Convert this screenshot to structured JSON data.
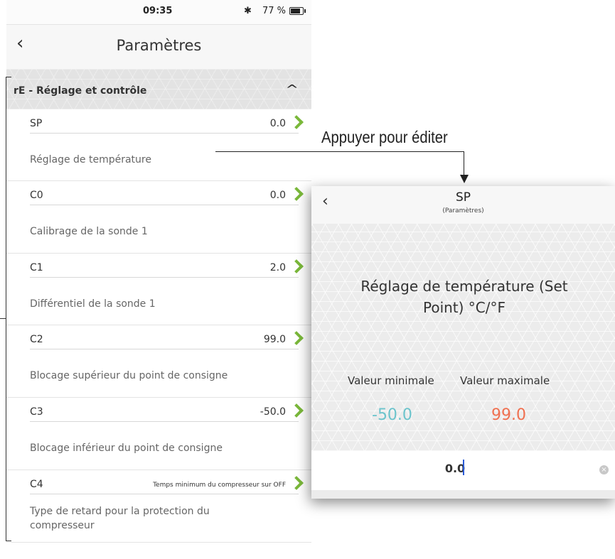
{
  "status_bar": {
    "time": "09:35",
    "bluetooth": "✱",
    "battery": "77 %"
  },
  "nav": {
    "back_icon": "‹",
    "title": "Paramètres"
  },
  "section": {
    "title": "rE - Réglage et contrôle",
    "chevron": "^"
  },
  "params": [
    {
      "code": "SP",
      "value": "0.0",
      "description": "Réglage de température"
    },
    {
      "code": "C0",
      "value": "0.0",
      "description": "Calibrage de la sonde 1"
    },
    {
      "code": "C1",
      "value": "2.0",
      "description": "Différentiel de la sonde 1"
    },
    {
      "code": "C2",
      "value": "99.0",
      "description": "Blocage supérieur du point de consigne"
    },
    {
      "code": "C3",
      "value": "-50.0",
      "description": "Blocage inférieur du point de consigne"
    },
    {
      "code": "C4",
      "value": "Temps minimum du compresseur sur OFF",
      "description": "Type de retard pour la protection du compresseur"
    }
  ],
  "annotation": {
    "text": "Appuyer pour éditer"
  },
  "detail": {
    "back_icon": "‹",
    "title": "SP",
    "subtitle": "(Paramètres)",
    "description": "Réglage de température (Set Point) °C/°F",
    "min_label": "Valeur minimale",
    "max_label": "Valeur maximale",
    "min_value": "-50.0",
    "max_value": "99.0",
    "input_value": "0.0",
    "clear_icon": "×"
  },
  "colors": {
    "chevron_green": "#7ab83a",
    "min_teal": "#6cc4cc",
    "max_orange": "#f07050",
    "caret_blue": "#2a5bd7"
  }
}
